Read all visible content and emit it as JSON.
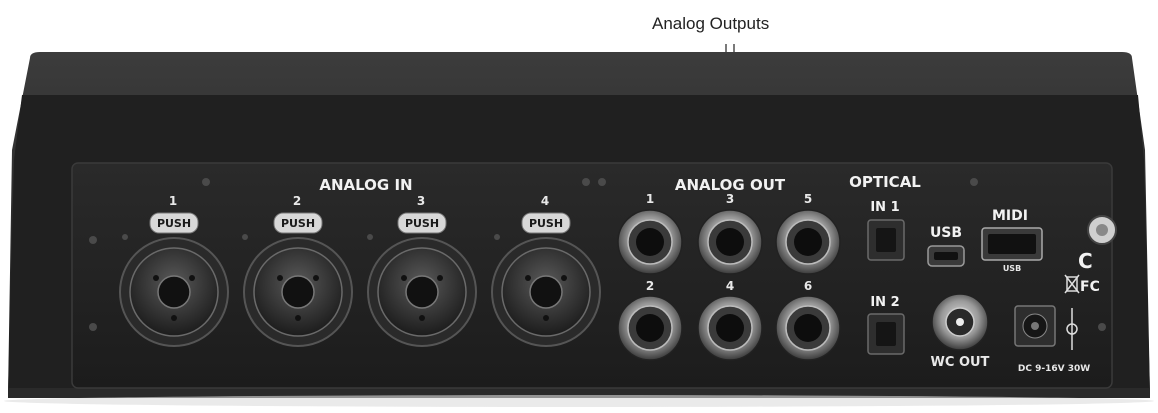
{
  "callout": {
    "text": "Analog Outputs"
  },
  "sections": {
    "analog_in": "ANALOG IN",
    "analog_out": "ANALOG OUT",
    "optical": "OPTICAL",
    "midi": "MIDI"
  },
  "analog_in_channels": [
    "1",
    "2",
    "3",
    "4"
  ],
  "push_label": "PUSH",
  "analog_out_channels": [
    "1",
    "3",
    "5",
    "2",
    "4",
    "6"
  ],
  "optical_inputs": [
    "IN 1",
    "IN 2"
  ],
  "usb": {
    "label": "USB",
    "midi_sub": "USB"
  },
  "wordclock": "WC OUT",
  "power": "DC 9-16V 30W",
  "marks": {
    "ce": "C",
    "fc": "FC"
  }
}
